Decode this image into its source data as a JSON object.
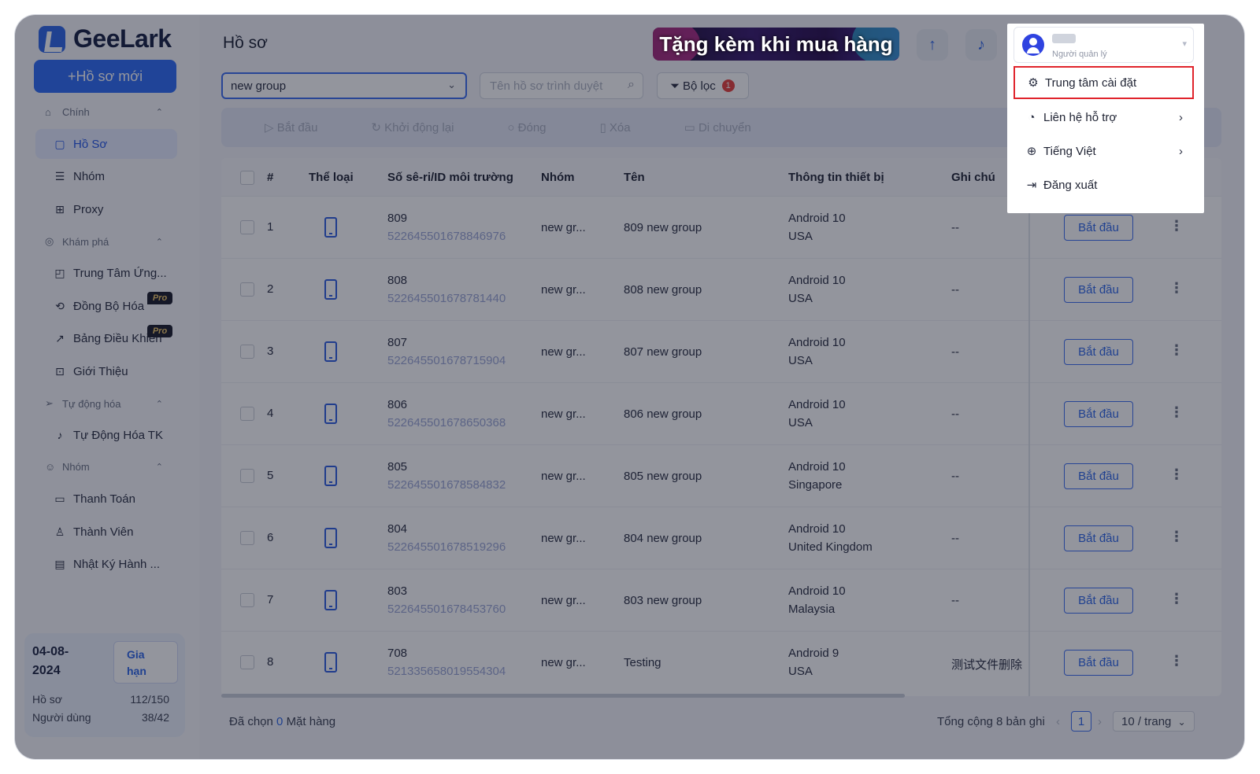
{
  "brand": {
    "name": "GeeLark"
  },
  "sidebar": {
    "new_profile": "+Hồ sơ mới",
    "sections": [
      {
        "label": "Chính",
        "icon": "home-icon"
      },
      {
        "label": "Khám phá",
        "icon": "explore-icon"
      },
      {
        "label": "Tự động hóa",
        "icon": "automation-icon"
      },
      {
        "label": "Nhóm",
        "icon": "team-icon"
      }
    ],
    "items": [
      {
        "label": "Hồ Sơ",
        "icon": "profile-icon",
        "active": true
      },
      {
        "label": "Nhóm",
        "icon": "list-icon"
      },
      {
        "label": "Proxy",
        "icon": "proxy-icon"
      },
      {
        "label": "Trung Tâm Ứng...",
        "icon": "app-center-icon"
      },
      {
        "label": "Đồng Bộ Hóa",
        "icon": "sync-icon",
        "badge": "Pro"
      },
      {
        "label": "Bảng Điều Khiển",
        "icon": "dashboard-icon",
        "badge": "Pro"
      },
      {
        "label": "Giới Thiệu",
        "icon": "gift-icon"
      },
      {
        "label": "Tự Động Hóa TK",
        "icon": "tiktok-icon"
      },
      {
        "label": "Thanh Toán",
        "icon": "billing-icon"
      },
      {
        "label": "Thành Viên",
        "icon": "members-icon"
      },
      {
        "label": "Nhật Ký Hành ...",
        "icon": "log-icon"
      }
    ],
    "plan": {
      "date_line1": "04-08-",
      "date_line2": "2024",
      "renew_line1": "Gia",
      "renew_line2": "hạn",
      "profiles_label": "Hồ sơ",
      "profiles_value": "112/150",
      "users_label": "Người dùng",
      "users_value": "38/42"
    }
  },
  "header": {
    "title": "Hồ sơ",
    "promo": "Tặng kèm khi mua hàng"
  },
  "toolbar": {
    "group_select": "new group",
    "search_placeholder": "Tên hồ sơ trình duyệt",
    "filter_label": "Bộ lọc",
    "filter_count": "1",
    "actions": [
      "Bắt đầu",
      "Khởi động lại",
      "Đóng",
      "Xóa",
      "Di chuyển"
    ]
  },
  "table": {
    "headers": [
      "#",
      "Thể loại",
      "Số sê-ri/ID môi trường",
      "Nhóm",
      "Tên",
      "Thông tin thiết bị",
      "Ghi chú"
    ],
    "start_label": "Bắt đầu",
    "rows": [
      {
        "num": "1",
        "serial": "809",
        "env_id": "522645501678846976",
        "group": "new gr...",
        "name": "809 new group",
        "os": "Android 10",
        "region": "USA",
        "note": "--"
      },
      {
        "num": "2",
        "serial": "808",
        "env_id": "522645501678781440",
        "group": "new gr...",
        "name": "808 new group",
        "os": "Android 10",
        "region": "USA",
        "note": "--"
      },
      {
        "num": "3",
        "serial": "807",
        "env_id": "522645501678715904",
        "group": "new gr...",
        "name": "807 new group",
        "os": "Android 10",
        "region": "USA",
        "note": "--"
      },
      {
        "num": "4",
        "serial": "806",
        "env_id": "522645501678650368",
        "group": "new gr...",
        "name": "806 new group",
        "os": "Android 10",
        "region": "USA",
        "note": "--"
      },
      {
        "num": "5",
        "serial": "805",
        "env_id": "522645501678584832",
        "group": "new gr...",
        "name": "805 new group",
        "os": "Android 10",
        "region": "Singapore",
        "note": "--"
      },
      {
        "num": "6",
        "serial": "804",
        "env_id": "522645501678519296",
        "group": "new gr...",
        "name": "804 new group",
        "os": "Android 10",
        "region": "United Kingdom",
        "note": "--"
      },
      {
        "num": "7",
        "serial": "803",
        "env_id": "522645501678453760",
        "group": "new gr...",
        "name": "803 new group",
        "os": "Android 10",
        "region": "Malaysia",
        "note": "--"
      },
      {
        "num": "8",
        "serial": "708",
        "env_id": "521335658019554304",
        "group": "new gr...",
        "name": "Testing",
        "os": "Android 9",
        "region": "USA",
        "note": "测试文件删除"
      }
    ]
  },
  "footer": {
    "selected_prefix": "Đã chọn",
    "selected_count": "0",
    "selected_suffix": "Mặt hàng",
    "total": "Tổng cộng 8 bản ghi",
    "page": "1",
    "page_size": "10 / trang"
  },
  "user_menu": {
    "role": "Người quản lý",
    "items": [
      {
        "label": "Trung tâm cài đặt",
        "icon": "settings-icon"
      },
      {
        "label": "Liên hệ hỗ trợ",
        "icon": "support-icon"
      },
      {
        "label": "Tiếng Việt",
        "icon": "globe-icon"
      },
      {
        "label": "Đăng xuất",
        "icon": "logout-icon"
      }
    ]
  },
  "colors": {
    "accent": "#2f6cf6",
    "highlight": "#e0242c",
    "badge": "#e8403c"
  }
}
